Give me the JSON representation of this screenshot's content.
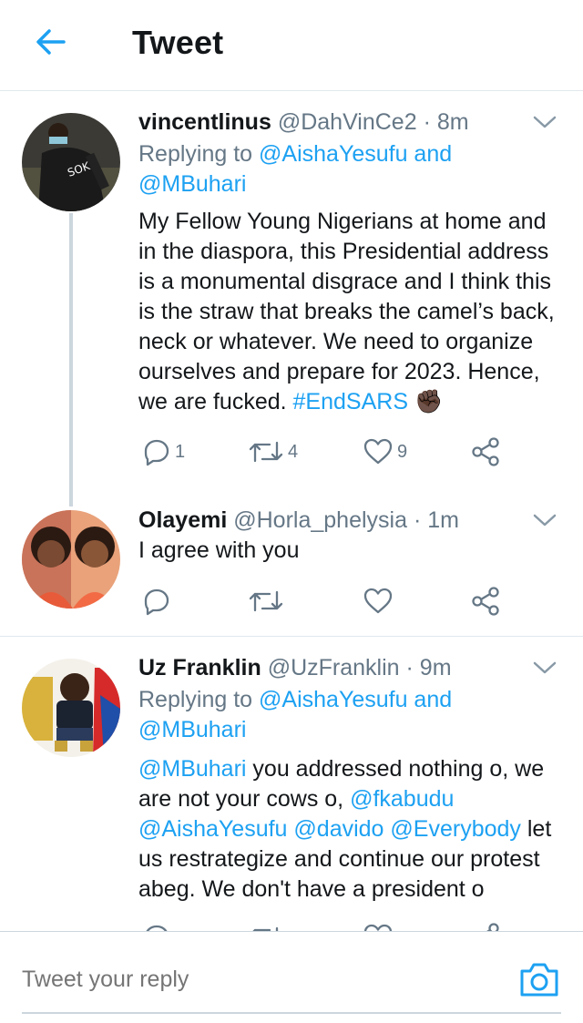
{
  "header": {
    "title": "Tweet"
  },
  "tweets": [
    {
      "name": "vincentlinus",
      "handle": "@DahVinCe2",
      "separator": "·",
      "time": "8m",
      "replying_prefix": "Replying to",
      "replying_to": "@AishaYesufu and @MBuhari",
      "text_lines": [
        "My Fellow Young Nigerians at home and",
        "in the diaspora, this Presidential address",
        "is a monumental disgrace and I think this",
        "is the straw that breaks the camel’s back,",
        "neck or whatever. We need to organize",
        "ourselves and prepare for 2023. Hence,",
        "we are fucked. "
      ],
      "hashtag": "#EndSARS",
      "emoji": "✊🏿",
      "reply_count": "1",
      "retweet_count": "4",
      "like_count": "9"
    },
    {
      "name": "Olayemi",
      "handle": "@Horla_phelysia",
      "separator": "·",
      "time": "1m",
      "text": "I agree with you",
      "reply_count": "",
      "retweet_count": "",
      "like_count": ""
    },
    {
      "name": "Uz Franklin",
      "handle": "@UzFranklin",
      "separator": "·",
      "time": "9m",
      "replying_prefix": "Replying to",
      "replying_to": "@AishaYesufu and @MBuhari",
      "mention1": "@MBuhari",
      "text_a": " you addressed nothing o, we are not your cows o, ",
      "mention2": "@fkabudu",
      "mention3": "@AishaYesufu",
      "mention4": "@davido",
      "mention5": "@Everybody",
      "text_b": " let us restrategize and continue our protest abeg. We don't have a president o"
    }
  ],
  "reply_box": {
    "placeholder": "Tweet your reply"
  },
  "colors": {
    "accent": "#1da1f2",
    "muted": "#657786",
    "text": "#14171a",
    "border": "#e1e8ed"
  },
  "icons": [
    "back-arrow-icon",
    "chevron-down-icon",
    "reply-icon",
    "retweet-icon",
    "like-icon",
    "share-icon",
    "camera-icon"
  ]
}
